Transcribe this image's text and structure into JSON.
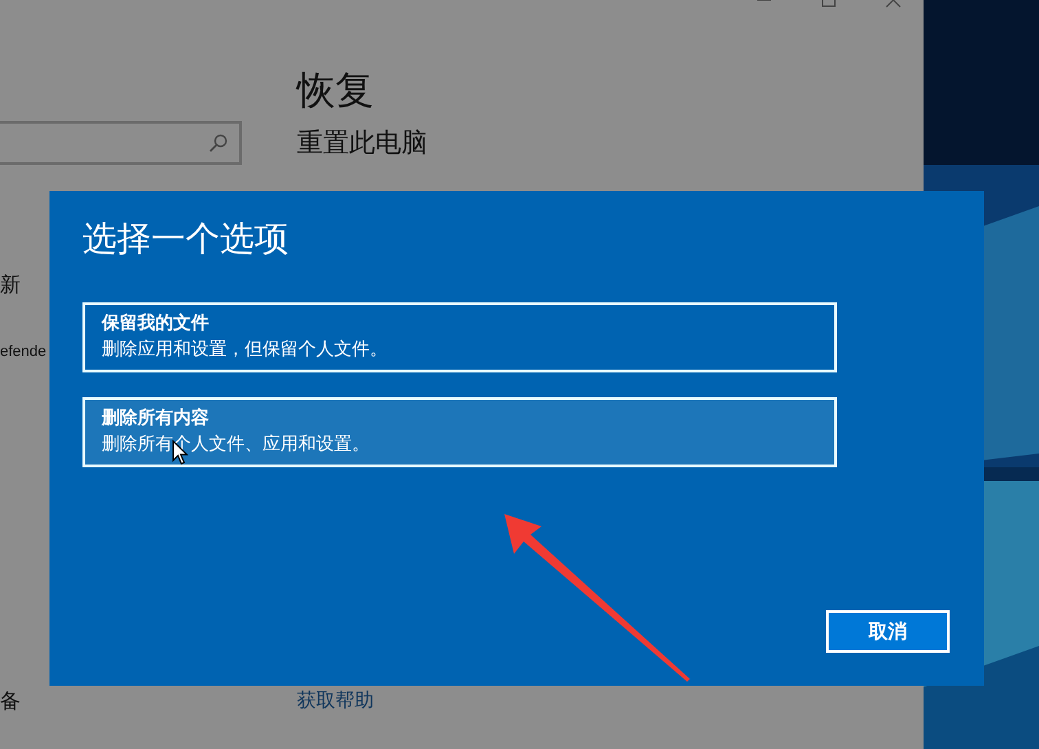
{
  "settings_window": {
    "heading": "恢复",
    "subheading": "重置此电脑",
    "sidebar_items": [
      "新",
      "efende",
      "备"
    ],
    "help_link": "获取帮助"
  },
  "dialog": {
    "title": "选择一个选项",
    "options": [
      {
        "title": "保留我的文件",
        "description": "删除应用和设置，但保留个人文件。",
        "hovered": false
      },
      {
        "title": "删除所有内容",
        "description": "删除所有个人文件、应用和设置。",
        "hovered": true
      }
    ],
    "buttons": [
      "取消"
    ]
  }
}
